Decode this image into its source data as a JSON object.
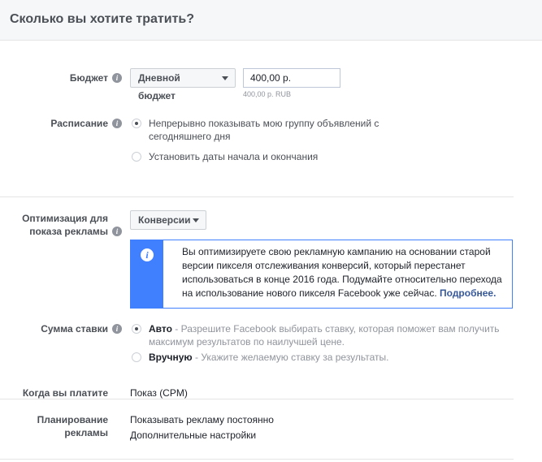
{
  "header": {
    "title": "Сколько вы хотите тратить?"
  },
  "budget": {
    "label": "Бюджет",
    "type_dropdown": "Дневной бюджет",
    "amount_value": "400,00 р.",
    "amount_hint": "400,00 р. RUB"
  },
  "schedule": {
    "label": "Расписание",
    "options": [
      {
        "text": "Непрерывно показывать мою группу объявлений с сегодняшнего дня",
        "selected": true
      },
      {
        "text": "Установить даты начала и окончания",
        "selected": false
      }
    ]
  },
  "optimization": {
    "label_line1": "Оптимизация для",
    "label_line2": "показа рекламы",
    "dropdown": "Конверсии",
    "notice_text": "Вы оптимизируете свою рекламную кампанию на основании старой версии пикселя отслеживания конверсий, который перестанет использоваться в конце 2016 года. Подумайте относительно перехода на использование нового пикселя Facebook уже сейчас.",
    "notice_link": "Подробнее."
  },
  "bid": {
    "label": "Сумма ставки",
    "auto_title": "Авто",
    "auto_desc": " - Разрешите Facebook выбирать ставку, которая поможет вам получить максимум результатов по наилучшей цене.",
    "manual_title": "Вручную",
    "manual_desc": " - Укажите желаемую ставку за результаты.",
    "selected": "auto"
  },
  "payment": {
    "label": "Когда вы платите",
    "value": "Показ (CPM)"
  },
  "delivery": {
    "label_line1": "Планирование",
    "label_line2": "рекламы",
    "value": "Показывать рекламу постоянно",
    "more_link": "Дополнительные настройки"
  },
  "icons": {
    "info": "i",
    "notice": "i"
  },
  "colors": {
    "accent": "#4080ff",
    "link": "#365899",
    "header_bg": "#f6f7f9"
  }
}
